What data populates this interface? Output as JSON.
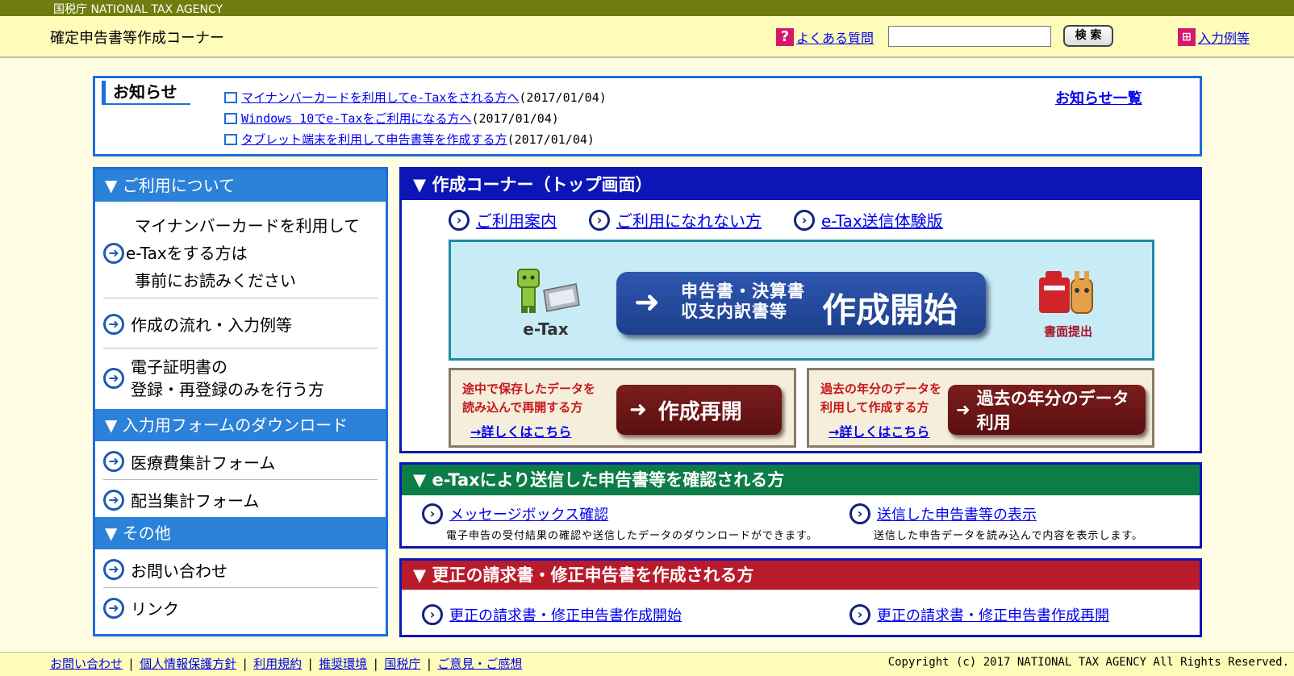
{
  "topbar": {
    "agency": "国税庁 NATIONAL TAX AGENCY"
  },
  "header": {
    "title": "確定申告書等作成コーナー",
    "faq_label": "よくある質問",
    "search_placeholder": "",
    "search_button": "検 索",
    "examples_label": "入力例等"
  },
  "notice": {
    "title": "お知らせ",
    "items": [
      {
        "link": "マイナンバーカードを利用してe-Taxをされる方へ",
        "date": "(2017/01/04)"
      },
      {
        "link": "Windows 10でe-Taxをご利用になる方へ",
        "date": "(2017/01/04)"
      },
      {
        "link": "タブレット端末を利用して申告書等を作成する方",
        "date": "(2017/01/04)"
      }
    ],
    "all_link": "お知らせ一覧"
  },
  "sidebar": {
    "sections": [
      {
        "title": "▼ ご利用について"
      },
      {
        "title": "▼ 入力用フォームのダウンロード"
      },
      {
        "title": "▼ その他"
      }
    ],
    "items": {
      "mynumber_1": "マイナンバーカードを利用して",
      "mynumber_2": "e-Taxをする方は",
      "mynumber_3": "事前にお読みください",
      "flow": "作成の流れ・入力例等",
      "cert_1": "電子証明書の",
      "cert_2": "登録・再登録のみを行う方",
      "medical": "医療費集計フォーム",
      "dividend": "配当集計フォーム",
      "contact": "お問い合わせ",
      "links": "リンク"
    }
  },
  "main": {
    "title": "▼ 作成コーナー（トップ画面）",
    "links": [
      "ご利用案内",
      "ご利用になれない方",
      "e-Tax送信体験版"
    ],
    "etax_label": "e-Tax",
    "start_small_1": "申告書・決算書",
    "start_small_2": "収支内訳書等",
    "start_big": "作成開始",
    "paper_label": "書面提出",
    "resume": {
      "desc_1": "途中で保存したデータを",
      "desc_2": "読み込んで再開する方",
      "button": "作成再開",
      "more": "→詳しくはこちら"
    },
    "past": {
      "desc_1": "過去の年分のデータを",
      "desc_2": "利用して作成する方",
      "button": "過去の年分のデータ利用",
      "more": "→詳しくはこちら"
    }
  },
  "confirm": {
    "title": "▼ e-Taxにより送信した申告書等を確認される方",
    "items": [
      {
        "link": "メッセージボックス確認",
        "desc": "電子申告の受付結果の確認や送信したデータのダウンロードができます。"
      },
      {
        "link": "送信した申告書等の表示",
        "desc": "送信した申告データを読み込んで内容を表示します。"
      }
    ]
  },
  "correction": {
    "title": "▼ 更正の請求書・修正申告書を作成される方",
    "items": [
      "更正の請求書・修正申告書作成開始",
      "更正の請求書・修正申告書作成再開"
    ]
  },
  "footer": {
    "links": [
      "お問い合わせ",
      "個人情報保護方針",
      "利用規約",
      "推奨環境",
      "国税庁",
      "ご意見・ご感想"
    ],
    "separator": "|",
    "copyright": "Copyright (c) 2017 NATIONAL TAX AGENCY All Rights Reserved."
  },
  "colors": {
    "accent_blue": "#1d6ddc",
    "main_header": "#0c16b6",
    "confirm_header": "#0d7d47",
    "correction_header": "#b81c2b"
  },
  "icons": [
    "question-icon",
    "book-icon",
    "window-icon",
    "arrow-circle-icon",
    "etax-character-icon",
    "mailbox-icon"
  ]
}
